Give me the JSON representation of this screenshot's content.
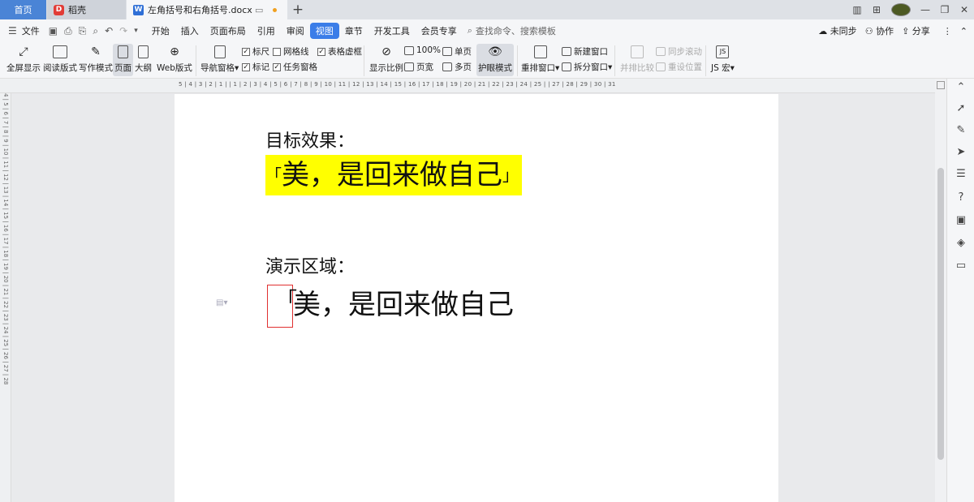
{
  "tabs": {
    "home": "首页",
    "doc1": "稻壳",
    "doc2": "左角括号和右角括号.docx"
  },
  "menu": {
    "file": "文件",
    "items": [
      "开始",
      "插入",
      "页面布局",
      "引用",
      "审阅",
      "视图",
      "章节",
      "开发工具",
      "会员专享"
    ],
    "active": "视图",
    "search_placeholder": "查找命令、搜索模板",
    "right": {
      "sync": "未同步",
      "collab": "协作",
      "share": "分享"
    }
  },
  "ribbon": {
    "fullscreen": "全屏显示",
    "reading": "阅读版式",
    "writing": "写作模式",
    "page": "页面",
    "outline": "大纲",
    "web": "Web版式",
    "nav_pane": "导航窗格",
    "ruler": "标尺",
    "gridlines": "网格线",
    "table_grid": "表格虚框",
    "marks": "标记",
    "task_pane": "任务窗格",
    "zoom": "显示比例",
    "zoom_100": "100%",
    "page_width": "页宽",
    "one_page": "单页",
    "multi_page": "多页",
    "eye_mode": "护眼模式",
    "rearrange": "重排窗口",
    "new_window": "新建窗口",
    "split": "拆分窗口",
    "side_by_side": "并排比较",
    "sync_scroll": "同步滚动",
    "reset_pos": "重设位置",
    "macro": "JS 宏"
  },
  "ruler": {
    "h_numbers": "5 | 4 | 3 | 2 | 1 |   | 1 | 2 | 3 | 4 | 5 | 6 | 7 | 8 | 9 | 10 | 11 | 12 | 13 | 14 | 15 | 16 | 17 | 18 | 19 | 20 | 21 | 22 | 23 | 24 | 25 |   | 27 | 28 | 29 | 30 | 31",
    "v_numbers": "4 | 5 | 6 | 7 | 8 | 9 | 10 | 11 | 12 | 13 | 14 | 15 | 16 | 17 | 18 | 19 | 20 | 21 | 22 | 23 | 24 | 25 | 26 | 27 | 28"
  },
  "document": {
    "heading_target": "目标效果：",
    "target_open": "「",
    "target_text": "美，是回来做自己",
    "target_close": "」",
    "heading_demo": "演示区域：",
    "demo_bracket": "「",
    "demo_text": "美，是回来做自己"
  },
  "colors": {
    "highlight": "#ffff00",
    "accent": "#3b7de8",
    "box_border": "#e03030"
  }
}
